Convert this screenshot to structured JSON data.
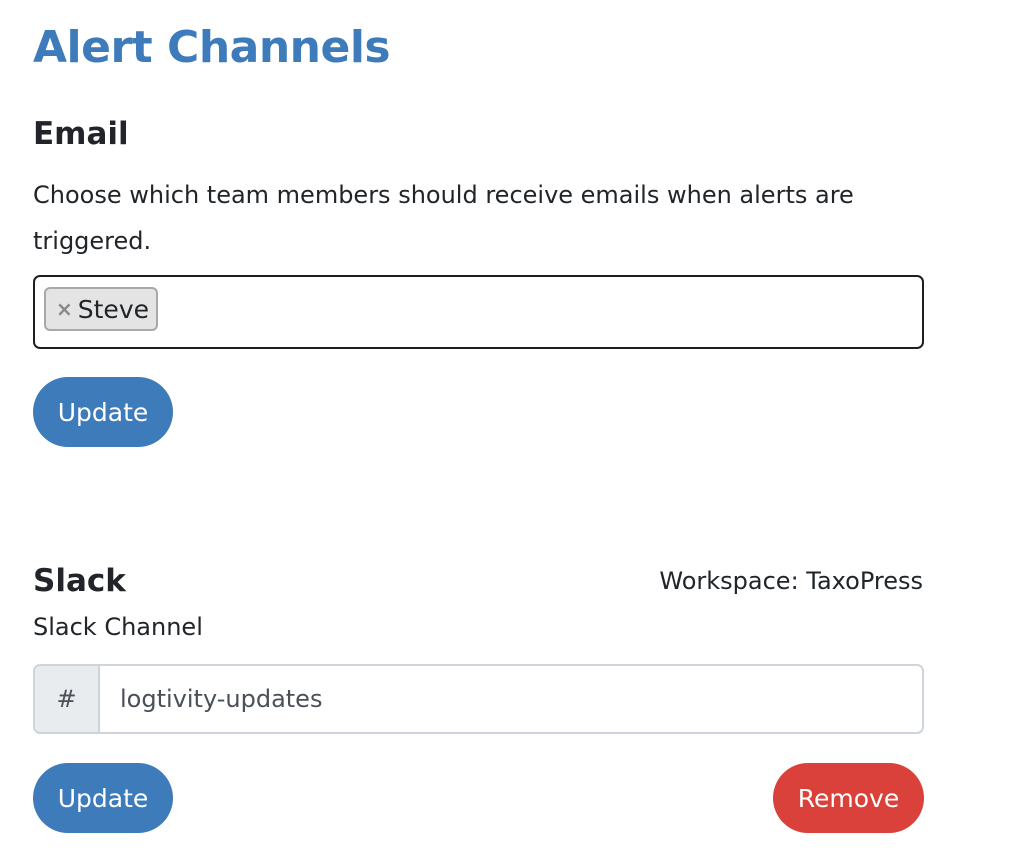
{
  "page": {
    "title": "Alert Channels"
  },
  "email": {
    "heading": "Email",
    "description": "Choose which team members should receive emails when alerts are triggered.",
    "tags": [
      {
        "remove_glyph": "×",
        "label": "Steve"
      }
    ],
    "update_label": "Update"
  },
  "slack": {
    "heading": "Slack",
    "workspace": "Workspace: TaxoPress",
    "channel_label": "Slack Channel",
    "channel_prefix": "#",
    "channel_value": "logtivity-updates",
    "update_label": "Update",
    "remove_label": "Remove"
  },
  "colors": {
    "accent": "#3d7bba",
    "danger": "#d9413a",
    "text": "#212529"
  }
}
